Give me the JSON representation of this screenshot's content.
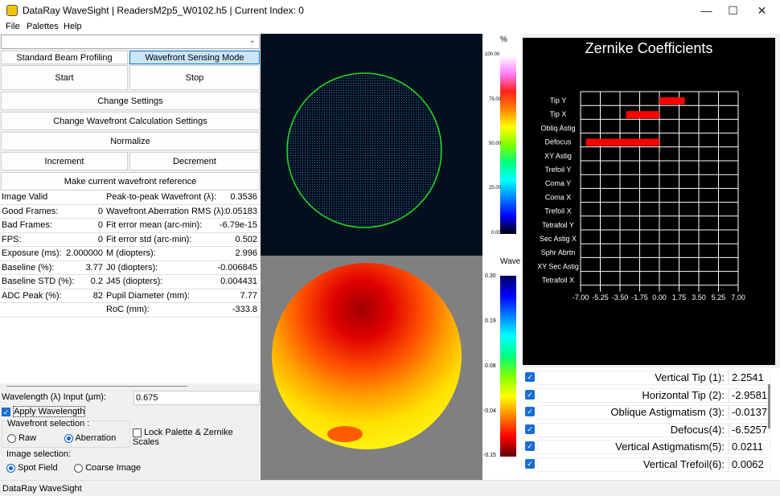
{
  "window": {
    "title": "DataRay WaveSight | ReadersM2p5_W0102.h5 | Current Index: 0",
    "minimize": "—",
    "maximize": "☐",
    "close": "✕",
    "app_icon": "dataray-app-icon"
  },
  "menu": {
    "file": "File",
    "palettes": "Palettes",
    "help": "Help"
  },
  "controls": {
    "combo_value": "",
    "standard_beam": "Standard Beam Profiling",
    "wavefront_mode": "Wavefront Sensing Mode",
    "start": "Start",
    "stop": "Stop",
    "change_settings": "Change Settings",
    "change_wavefront_settings": "Change Wavefront Calculation Settings",
    "normalize": "Normalize",
    "increment": "Increment",
    "decrement": "Decrement",
    "make_reference": "Make current wavefront reference"
  },
  "stats": [
    {
      "label": "Image Valid",
      "value": "",
      "label2": "Peak-to-peak Wavefront (λ):",
      "value2": "0.3536"
    },
    {
      "label": "Good Frames:",
      "value": "0",
      "label2": "Wavefront Aberration RMS (λ):",
      "value2": "0.05183"
    },
    {
      "label": "Bad Frames:",
      "value": "0",
      "label2": "Fit error mean (arc-min):",
      "value2": "-6.79e-15"
    },
    {
      "label": "FPS:",
      "value": "0",
      "label2": "Fit error std (arc-min):",
      "value2": "0.502"
    },
    {
      "label": "Exposure (ms):",
      "value": "2.000000",
      "label2": "M (diopters):",
      "value2": "2.996"
    },
    {
      "label": "Baseline (%):",
      "value": "3.77",
      "label2": "J0 (diopters):",
      "value2": "-0.006845"
    },
    {
      "label": "Baseline STD (%):",
      "value": "0.2",
      "label2": "J45 (diopters):",
      "value2": "0.004431"
    },
    {
      "label": "ADC Peak (%):",
      "value": "82",
      "label2": "Pupil Diameter (mm):",
      "value2": "7.77"
    },
    {
      "label": "",
      "value": "",
      "label2": "RoC (mm):",
      "value2": "-333.8"
    }
  ],
  "wavelength": {
    "label": "Wavelength (λ) Input (µm):",
    "value": "0.675",
    "apply": "Apply Wavelength",
    "apply_checked": true
  },
  "wavefront_selection": {
    "title": "Wavefront selection :",
    "raw": "Raw",
    "aberration": "Aberration",
    "selected": "aberration"
  },
  "lock_palette": {
    "label": "Lock Palette & Zernike Scales",
    "checked": false
  },
  "image_selection": {
    "title": "Image selection:",
    "spot": "Spot Field",
    "coarse": "Coarse Image",
    "selected": "spot"
  },
  "status": "DataRay WaveSight",
  "intensity_bar": {
    "unit": "%",
    "ticks": [
      "100.00",
      "75.00",
      "50.00",
      "25.00",
      "0.00"
    ]
  },
  "wave_bar": {
    "unit": "Wave",
    "ticks": [
      "0.30",
      "0.19",
      "0.08",
      "-0.04",
      "-0.15"
    ]
  },
  "chart_data": {
    "type": "bar",
    "orientation": "horizontal",
    "title": "Zernike Coefficients",
    "categories": [
      "Tip Y",
      "Tip X",
      "Obliq Astig",
      "Defocus",
      "XY Astig",
      "Trefoil Y",
      "Coma Y",
      "Coma X",
      "Trefoil X",
      "Tetrafoil Y",
      "Sec Astig X",
      "Sphr Abrtn",
      "XY Sec Astig",
      "Tetrafoil X"
    ],
    "values": [
      2.2541,
      -2.9581,
      -0.0137,
      -6.5257,
      0.0211,
      0.0062,
      0,
      0,
      0,
      0,
      0,
      0,
      0,
      0
    ],
    "xticks": [
      "-7.00",
      "-5.25",
      "-3.50",
      "-1.75",
      "0.00",
      "1.75",
      "3.50",
      "5.25",
      "7.00"
    ],
    "xlim": [
      -7,
      7
    ],
    "bar_color": "#ff0000",
    "grid": true
  },
  "zernike_list": [
    {
      "label": "Vertical Tip (1):",
      "value": "2.2541",
      "checked": true
    },
    {
      "label": "Horizontal Tip (2):",
      "value": "-2.9581",
      "checked": true
    },
    {
      "label": "Oblique Astigmatism (3):",
      "value": "-0.0137",
      "checked": true
    },
    {
      "label": "Defocus(4):",
      "value": "-6.5257",
      "checked": true
    },
    {
      "label": "Vertical Astigmatism(5):",
      "value": "0.0211",
      "checked": true
    },
    {
      "label": "Vertical Trefoil(6):",
      "value": "0.0062",
      "checked": true
    }
  ]
}
